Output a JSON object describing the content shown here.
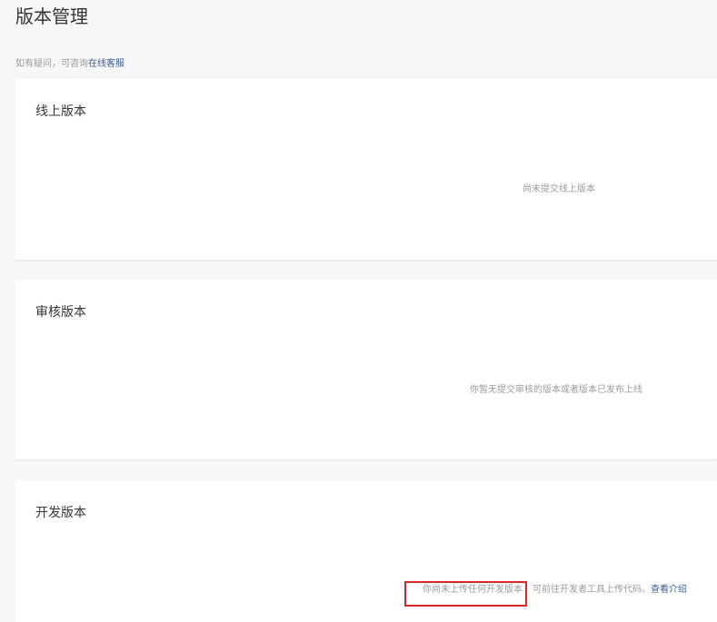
{
  "page": {
    "title": "版本管理"
  },
  "help": {
    "prefix": "如有疑问，可咨询",
    "link_label": "在线客服"
  },
  "sections": {
    "online": {
      "title": "线上版本",
      "empty_text": "尚未提交线上版本"
    },
    "review": {
      "title": "审核版本",
      "empty_text": "你暂无提交审核的版本或者版本已发布上线"
    },
    "dev": {
      "title": "开发版本",
      "empty_text": "你尚未上传任何开发版本",
      "hint_text": "可前往开发者工具上传代码。",
      "link_label": "查看介绍"
    }
  },
  "colors": {
    "link": "#3d5c8a",
    "highlight_border": "#d9262a",
    "muted_text": "#9a9a9a",
    "background": "#f6f7f9"
  }
}
